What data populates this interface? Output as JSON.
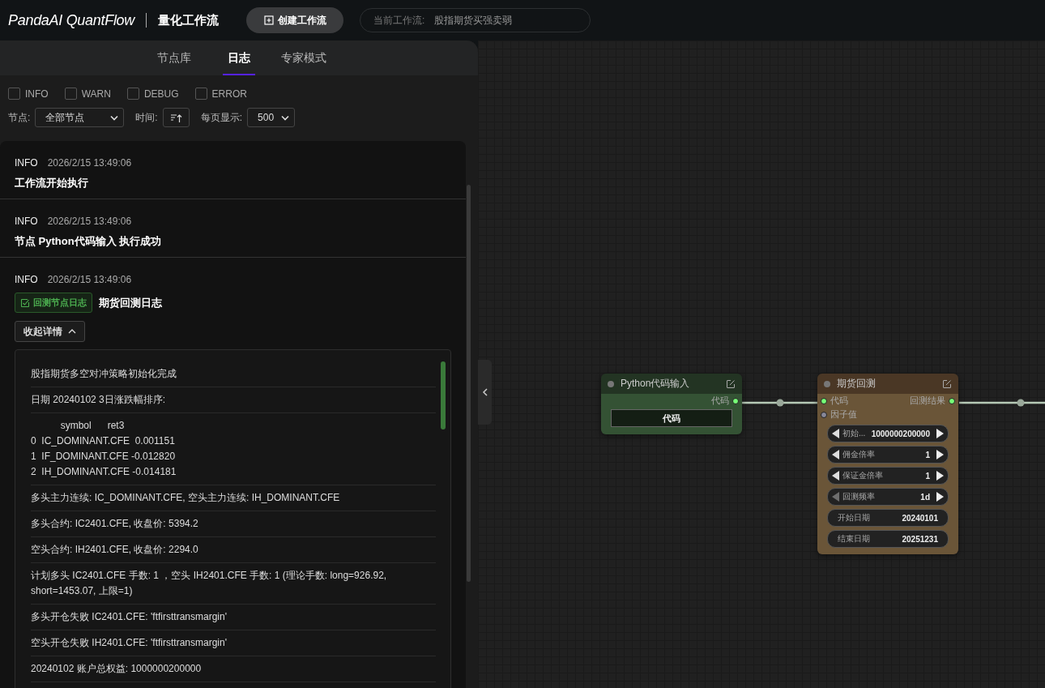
{
  "header": {
    "logo": "PandaAI QuantFlow",
    "title": "量化工作流",
    "create_button": "创建工作流",
    "current_label": "当前工作流:",
    "current_value": "股指期货买强卖弱"
  },
  "tabs": [
    {
      "label": "节点库",
      "selected": false
    },
    {
      "label": "日志",
      "selected": true
    },
    {
      "label": "专家模式",
      "selected": false
    }
  ],
  "level_filters": [
    {
      "label": "INFO",
      "checked": false
    },
    {
      "label": "WARN",
      "checked": false
    },
    {
      "label": "DEBUG",
      "checked": false
    },
    {
      "label": "ERROR",
      "checked": false
    }
  ],
  "controls": {
    "node_label": "节点:",
    "node_select": "全部节点",
    "time_label": "时间:",
    "page_size_label": "每页显示:",
    "page_size": "500"
  },
  "logs": [
    {
      "level": "INFO",
      "time": "2026/2/15 13:49:06",
      "message": "工作流开始执行"
    },
    {
      "level": "INFO",
      "time": "2026/2/15 13:49:06",
      "message": "节点 Python代码输入 执行成功"
    },
    {
      "level": "INFO",
      "time": "2026/2/15 13:49:06",
      "tag": "回测节点日志",
      "message": "期货回测日志",
      "toggle": "收起详情",
      "expanded": true,
      "details": [
        "股指期货多空对冲策略初始化完成",
        "日期 20240102 3日涨跌幅排序:",
        "           symbol      ret3\n0  IC_DOMINANT.CFE  0.001151\n1  IF_DOMINANT.CFE -0.012820\n2  IH_DOMINANT.CFE -0.014181",
        "多头主力连续: IC_DOMINANT.CFE, 空头主力连续: IH_DOMINANT.CFE",
        "多头合约: IC2401.CFE, 收盘价: 5394.2",
        "空头合约: IH2401.CFE, 收盘价: 2294.0",
        "计划多头 IC2401.CFE 手数: 1 ，空头 IH2401.CFE 手数: 1 (理论手数: long=926.92, short=1453.07, 上限=1)",
        "多头开仓失败 IC2401.CFE: 'ftfirsttransmargin'",
        "空头开仓失败 IH2401.CFE: 'ftfirsttransmargin'",
        "20240102 账户总权益: 1000000200000"
      ]
    }
  ],
  "nodes": [
    {
      "kind": "python",
      "title": "Python代码输入",
      "outputs": [
        {
          "label": "代码",
          "connected": true
        }
      ],
      "widgets": [
        {
          "kind": "button",
          "label": "代码"
        }
      ]
    },
    {
      "kind": "backtest",
      "title": "期货回测",
      "inputs": [
        {
          "label": "代码",
          "connected": true
        },
        {
          "label": "因子值",
          "connected": false
        }
      ],
      "outputs": [
        {
          "label": "回测结果",
          "connected": true
        }
      ],
      "widgets": [
        {
          "kind": "stepper",
          "label": "初始...",
          "value": "1000000200000",
          "prev_disabled": false
        },
        {
          "kind": "stepper",
          "label": "佣金倍率",
          "value": "1",
          "prev_disabled": false
        },
        {
          "kind": "stepper",
          "label": "保证金倍率",
          "value": "1",
          "prev_disabled": false
        },
        {
          "kind": "stepper",
          "label": "回测频率",
          "value": "1d",
          "prev_disabled": true
        },
        {
          "kind": "text",
          "label": "开始日期",
          "value": "20240101"
        },
        {
          "kind": "text",
          "label": "结束日期",
          "value": "20251231"
        }
      ]
    }
  ]
}
